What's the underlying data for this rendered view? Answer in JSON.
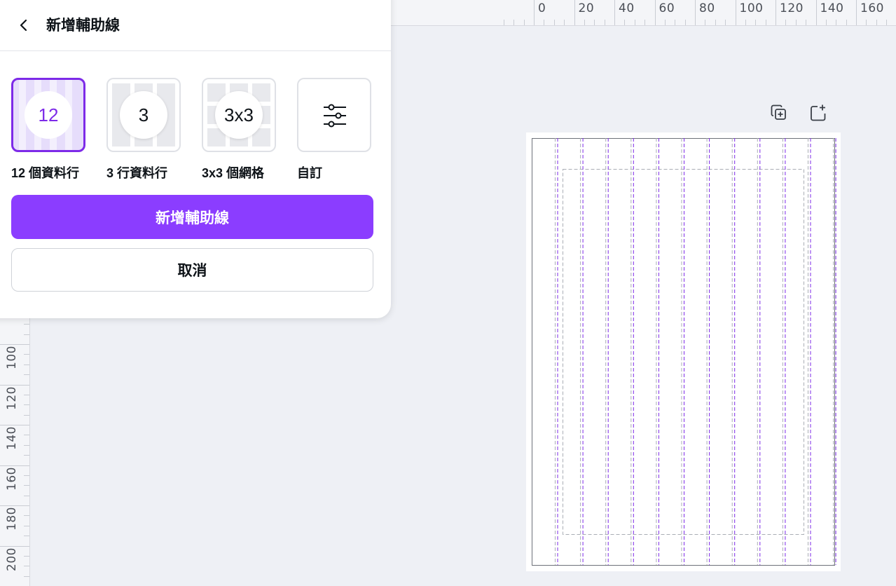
{
  "ruler_top": {
    "labels": [
      "0",
      "20",
      "40",
      "60",
      "80",
      "100",
      "120",
      "140",
      "160"
    ]
  },
  "ruler_left": {
    "labels": [
      "100",
      "120",
      "140",
      "160",
      "180",
      "200"
    ]
  },
  "panel": {
    "title": "新增輔助線",
    "back_icon": "chevron-left-icon",
    "options": [
      {
        "id": "12-columns",
        "badge": "12",
        "label": "12 個資料行",
        "selected": true
      },
      {
        "id": "3-columns",
        "badge": "3",
        "label": "3 行資料行",
        "selected": false
      },
      {
        "id": "3x3-grid",
        "badge": "3x3",
        "label": "3x3 個網格",
        "selected": false
      },
      {
        "id": "custom",
        "icon": "sliders-icon",
        "label": "自訂",
        "selected": false
      }
    ],
    "primary_button": "新增輔助線",
    "cancel_button": "取消"
  },
  "page_toolbar": {
    "duplicate_icon": "duplicate-page-icon",
    "add_icon": "add-page-icon"
  },
  "colors": {
    "accent": "#8b3dff",
    "accent_text": "#7d2ae8",
    "selected_bg": "#e6ddfb",
    "guide_purple": "#7d2ae8",
    "guide_gray": "#a9adb5",
    "canvas_bg": "#eef0f5"
  }
}
